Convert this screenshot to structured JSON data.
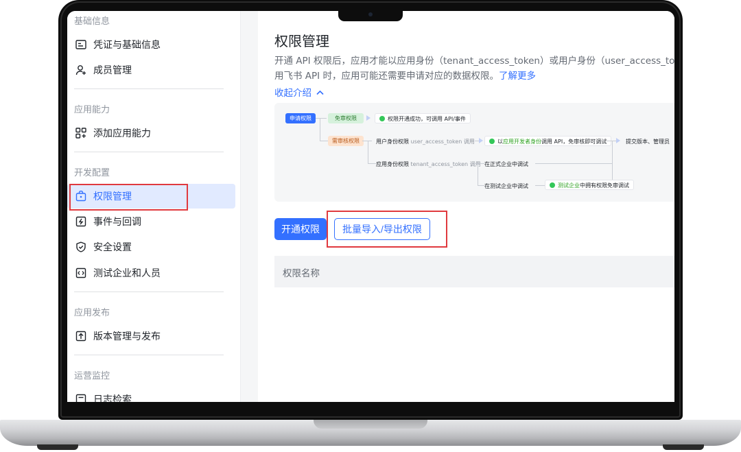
{
  "sidebar": {
    "groups": [
      {
        "title": "基础信息",
        "items": [
          {
            "label": "凭证与基础信息",
            "icon": "credential-icon"
          },
          {
            "label": "成员管理",
            "icon": "member-icon"
          }
        ]
      },
      {
        "title": "应用能力",
        "items": [
          {
            "label": "添加应用能力",
            "icon": "add-capability-icon"
          }
        ]
      },
      {
        "title": "开发配置",
        "items": [
          {
            "label": "权限管理",
            "icon": "permission-icon",
            "active": true
          },
          {
            "label": "事件与回调",
            "icon": "event-icon"
          },
          {
            "label": "安全设置",
            "icon": "security-icon"
          },
          {
            "label": "测试企业和人员",
            "icon": "test-icon"
          }
        ]
      },
      {
        "title": "应用发布",
        "items": [
          {
            "label": "版本管理与发布",
            "icon": "publish-icon"
          }
        ]
      },
      {
        "title": "运营监控",
        "items": [
          {
            "label": "日志检索",
            "icon": "log-icon"
          }
        ]
      }
    ]
  },
  "main": {
    "title": "权限管理",
    "desc_line1": "开通 API 权限后，应用才能以应用身份（tenant_access_token）或用户身份（user_access_token）调",
    "desc_line2": "用飞书 API 时，应用可能还需要申请对应的数据权限。",
    "learn_more": "了解更多",
    "collapse": "收起介绍",
    "flow": {
      "apply": "申请权限",
      "free": "免审权限",
      "free_result": "权限开通成功，可调用 API/事件",
      "review": "需审核权限",
      "user_token_label": "用户身份权限",
      "user_token": "user_access_token",
      "call": "调用",
      "user_result_prefix": "以",
      "user_result_highlight": "应用开发者身份",
      "user_result_suffix": "调用 API，免审核即可调试",
      "submit": "提交版本、管理员",
      "tenant_token_label": "应用身份权限",
      "tenant_token": "tenant_access_token",
      "prod_debug": "在正式企业中调试",
      "test_debug": "在测试企业中调试",
      "test_result_highlight": "测试企业",
      "test_result_suffix": "中拥有权限免审调试"
    },
    "buttons": {
      "open": "开通权限",
      "bulk": "批量导入/导出权限"
    },
    "table": {
      "columns": [
        "权限名称"
      ]
    }
  },
  "colors": {
    "accent": "#3370ff",
    "highlight_box": "#e0393e"
  }
}
